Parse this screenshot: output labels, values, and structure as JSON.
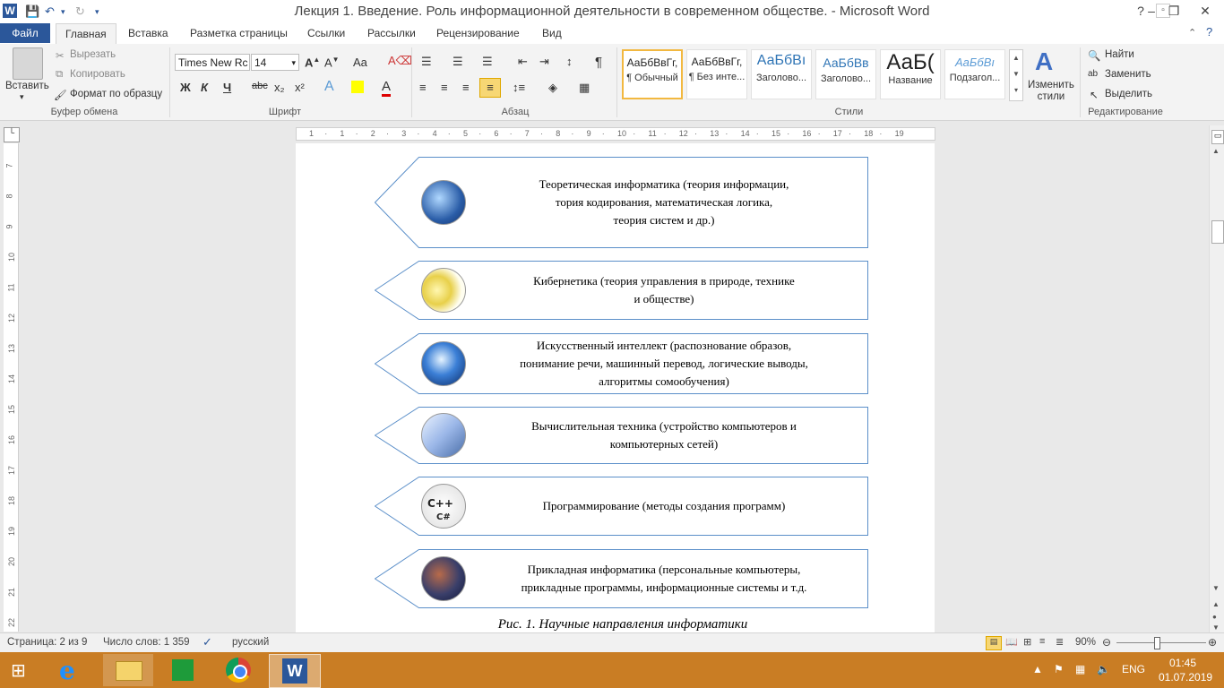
{
  "window": {
    "title": "Лекция 1. Введение. Роль информационной деятельности в современном обществе.  -  Microsoft Word",
    "app_icon": "W"
  },
  "tabs": [
    "Файл",
    "Главная",
    "Вставка",
    "Разметка страницы",
    "Ссылки",
    "Рассылки",
    "Рецензирование",
    "Вид"
  ],
  "clipboard": {
    "paste": "Вставить",
    "cut": "Вырезать",
    "copy": "Копировать",
    "format_painter": "Формат по образцу",
    "label": "Буфер обмена"
  },
  "font": {
    "name": "Times New Rc",
    "size": "14",
    "label": "Шрифт",
    "change_case": "Aa",
    "bold": "Ж",
    "italic": "К",
    "underline": "Ч",
    "strike": "abc",
    "subscript": "x₂",
    "superscript": "x²"
  },
  "paragraph": {
    "label": "Абзац"
  },
  "styles": {
    "label": "Стили",
    "items": [
      {
        "sample": "АаБбВвГг,",
        "name": "¶ Обычный"
      },
      {
        "sample": "АаБбВвГг,",
        "name": "¶ Без инте..."
      },
      {
        "sample": "АаБбВı",
        "name": "Заголово..."
      },
      {
        "sample": "АаБбВв",
        "name": "Заголово..."
      },
      {
        "sample": "АаБ(",
        "name": "Название"
      },
      {
        "sample": "АаБбВı",
        "name": "Подзагол..."
      }
    ],
    "change": "Изменить\nстили"
  },
  "editing": {
    "label": "Редактирование",
    "find": "Найти",
    "replace": "Заменить",
    "select": "Выделить"
  },
  "ruler_h": [
    "1",
    "·",
    "1",
    "·",
    "2",
    "·",
    "3",
    "·",
    "4",
    "·",
    "5",
    "·",
    "6",
    "·",
    "7",
    "·",
    "8",
    "·",
    "9",
    "·",
    "10",
    "·",
    "11",
    "·",
    "12",
    "·",
    "13",
    "·",
    "14",
    "·",
    "15",
    "·",
    "16",
    "·",
    "17",
    "·",
    "18",
    "·",
    "19"
  ],
  "ruler_v": [
    "7",
    "8",
    "9",
    "10",
    "11",
    "12",
    "13",
    "14",
    "15",
    "16",
    "17",
    "18",
    "19",
    "20",
    "21",
    "22"
  ],
  "diagram": [
    {
      "text": "Теоретическая  информатика  (теория  информации,\nтория  кодирования,  математическая  логика,\nтеория  систем и др.)",
      "icon": "computer-collage-icon"
    },
    {
      "text": "Кибернетика  (теория  управления  в природе,  технике\nи обществе)",
      "icon": "kibernetika-logo-icon"
    },
    {
      "text": "Искусственный  интеллект  (распознование  образов,\nпонимание  речи, машинный  перевод, логические  выводы,\nалгоритмы  сомообучения)",
      "icon": "ai-head-icon"
    },
    {
      "text": "Вычислительная  техника (устройство  компьютеров  и\nкомпьютерных   сетей)",
      "icon": "laptop-icon"
    },
    {
      "text": "Программирование  (методы  создания программ)",
      "icon": "cpp-csharp-icon"
    },
    {
      "text": "Прикладная  информатика  (персональные  компьютеры,\nприкладные  программы, информационные  системы  и т.д.",
      "icon": "applied-collage-icon"
    }
  ],
  "caption": "Рис. 1. Научные направления информатики",
  "status": {
    "page": "Страница: 2 из 9",
    "words": "Число слов: 1 359",
    "language": "русский",
    "zoom": "90%"
  },
  "taskbar": {
    "lang": "ENG",
    "time": "01:45",
    "date": "01.07.2019"
  }
}
